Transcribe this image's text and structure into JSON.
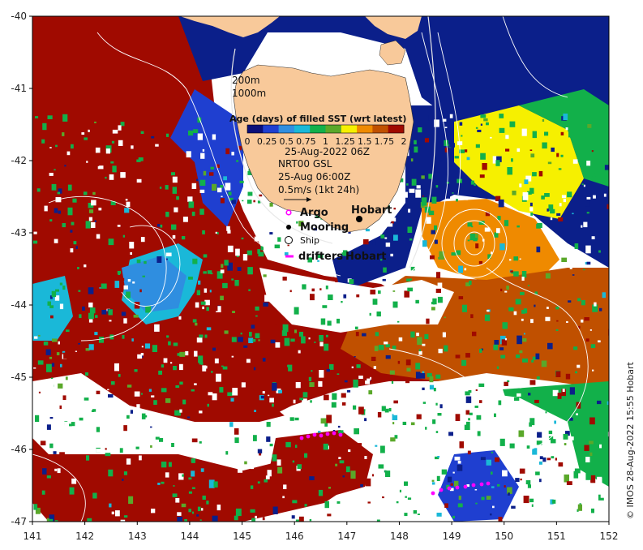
{
  "map": {
    "xticks": [
      "141",
      "142",
      "143",
      "144",
      "145",
      "146",
      "147",
      "148",
      "149",
      "150",
      "151",
      "152"
    ],
    "yticks": [
      "-40",
      "-41",
      "-42",
      "-43",
      "-44",
      "-45",
      "-46",
      "-47"
    ],
    "lon_range": [
      141,
      152
    ],
    "lat_range": [
      -47,
      -40
    ],
    "colors": {
      "land": "#f8c99a",
      "deep_blue": "#0b1f8a",
      "red": "#a00a00",
      "orange": "#ef8a00",
      "dark_orange": "#c05000",
      "green": "#12b04a",
      "cyan": "#1ab8d8",
      "light_blue": "#2f8ee0",
      "yellow": "#f6f000",
      "olive": "#5aa82a",
      "argo": "#ff00ff",
      "contour": "#ffffff"
    }
  },
  "depth_labels": {
    "d200": "200m",
    "d1000": "1000m"
  },
  "colorbar": {
    "title": "Age (days) of filled SST (wrt latest)",
    "ticks": [
      "0",
      "0.25",
      "0.5",
      "0.75",
      "1",
      "1.25",
      "1.5",
      "1.75",
      "2"
    ],
    "colors": [
      "#0a0f7a",
      "#1f3fd0",
      "#2f8ee0",
      "#1ab8d8",
      "#12b04a",
      "#5aa82a",
      "#f6f000",
      "#ef8a00",
      "#c05000",
      "#a00a00"
    ]
  },
  "info": {
    "date": "25-Aug-2022 06Z",
    "product": "NRT00 GSL",
    "time": "25-Aug 06:00Z",
    "scale": "0.5m/s (1kt 24h)"
  },
  "legend": {
    "argo": "Argo",
    "mooring": "Mooring",
    "ship": "Ship",
    "drifters": "drifters",
    "drifters_suffix": "Hobart"
  },
  "place": {
    "hobart": "Hobart"
  },
  "credit": "© IMOS 28-Aug-2022 15:55 Hobart"
}
